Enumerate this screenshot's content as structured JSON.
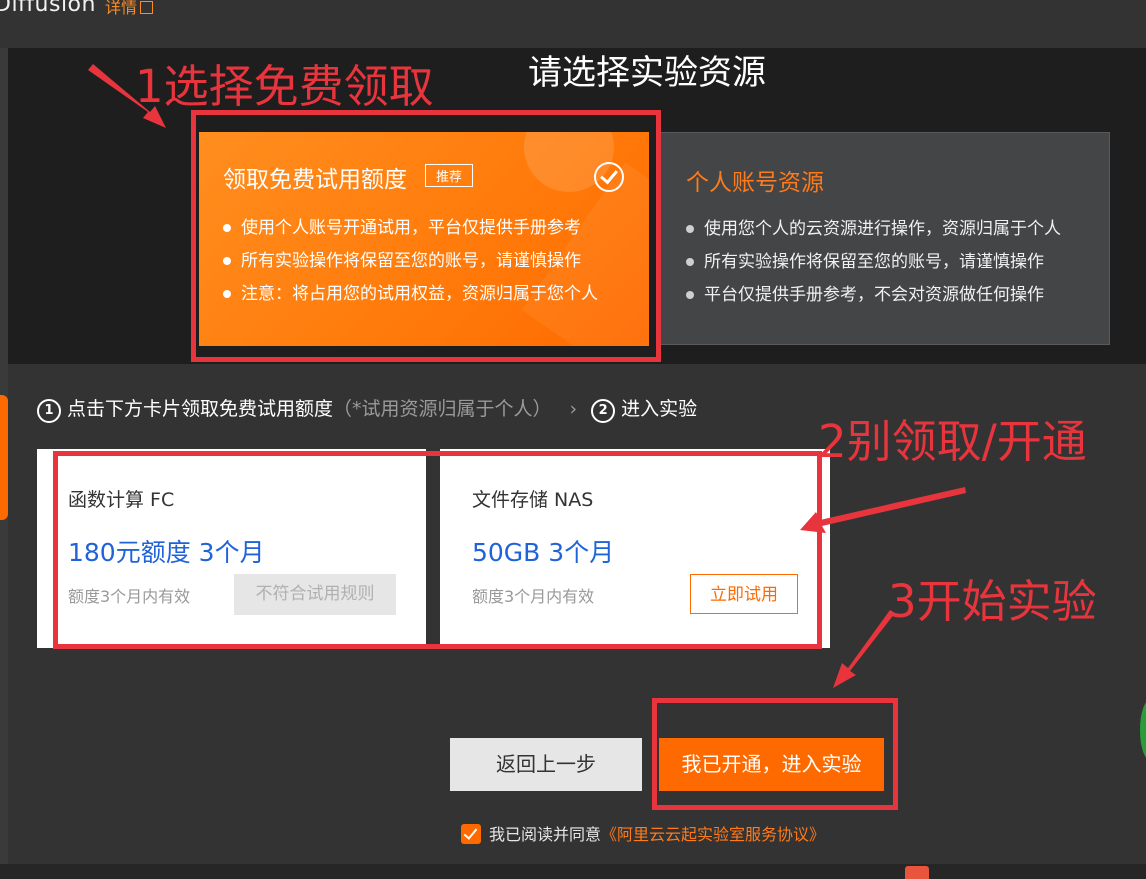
{
  "header": {
    "app_title": "Diffusion",
    "detail_link": "详情"
  },
  "page_title": "请选择实验资源",
  "resource_options": [
    {
      "title": "领取免费试用额度",
      "badge": "推荐",
      "selected": true,
      "bullets": [
        "使用个人账号开通试用，平台仅提供手册参考",
        "所有实验操作将保留至您的账号，请谨慎操作",
        "注意：将占用您的试用权益，资源归属于您个人"
      ]
    },
    {
      "title": "个人账号资源",
      "selected": false,
      "bullets": [
        "使用您个人的云资源进行操作，资源归属于个人",
        "所有实验操作将保留至您的账号，请谨慎操作",
        "平台仅提供手册参考，不会对资源做任何操作"
      ]
    }
  ],
  "steps": {
    "step1_num": "1",
    "step1_label": "点击下方卡片领取免费试用额度",
    "step1_hint": "（*试用资源归属于个人）",
    "separator": "›",
    "step2_num": "2",
    "step2_label": "进入实验"
  },
  "services": [
    {
      "name": "函数计算 FC",
      "quota": "180元额度 3个月",
      "note": "额度3个月内有效",
      "button": "不符合试用规则",
      "enabled": false
    },
    {
      "name": "文件存储 NAS",
      "quota": "50GB 3个月",
      "note": "额度3个月内有效",
      "button": "立即试用",
      "enabled": true
    }
  ],
  "buttons": {
    "back": "返回上一步",
    "enter": "我已开通，进入实验"
  },
  "agreement": {
    "checked": true,
    "prefix": "我已阅读并同意",
    "link": "《阿里云云起实验室服务协议》"
  },
  "annotations": [
    "1选择免费领取",
    "2别领取/开通",
    "3开始实验"
  ],
  "colors": {
    "accent": "#ff6a00",
    "annotation_red": "#e8343c",
    "link_blue": "#1f63d9"
  }
}
